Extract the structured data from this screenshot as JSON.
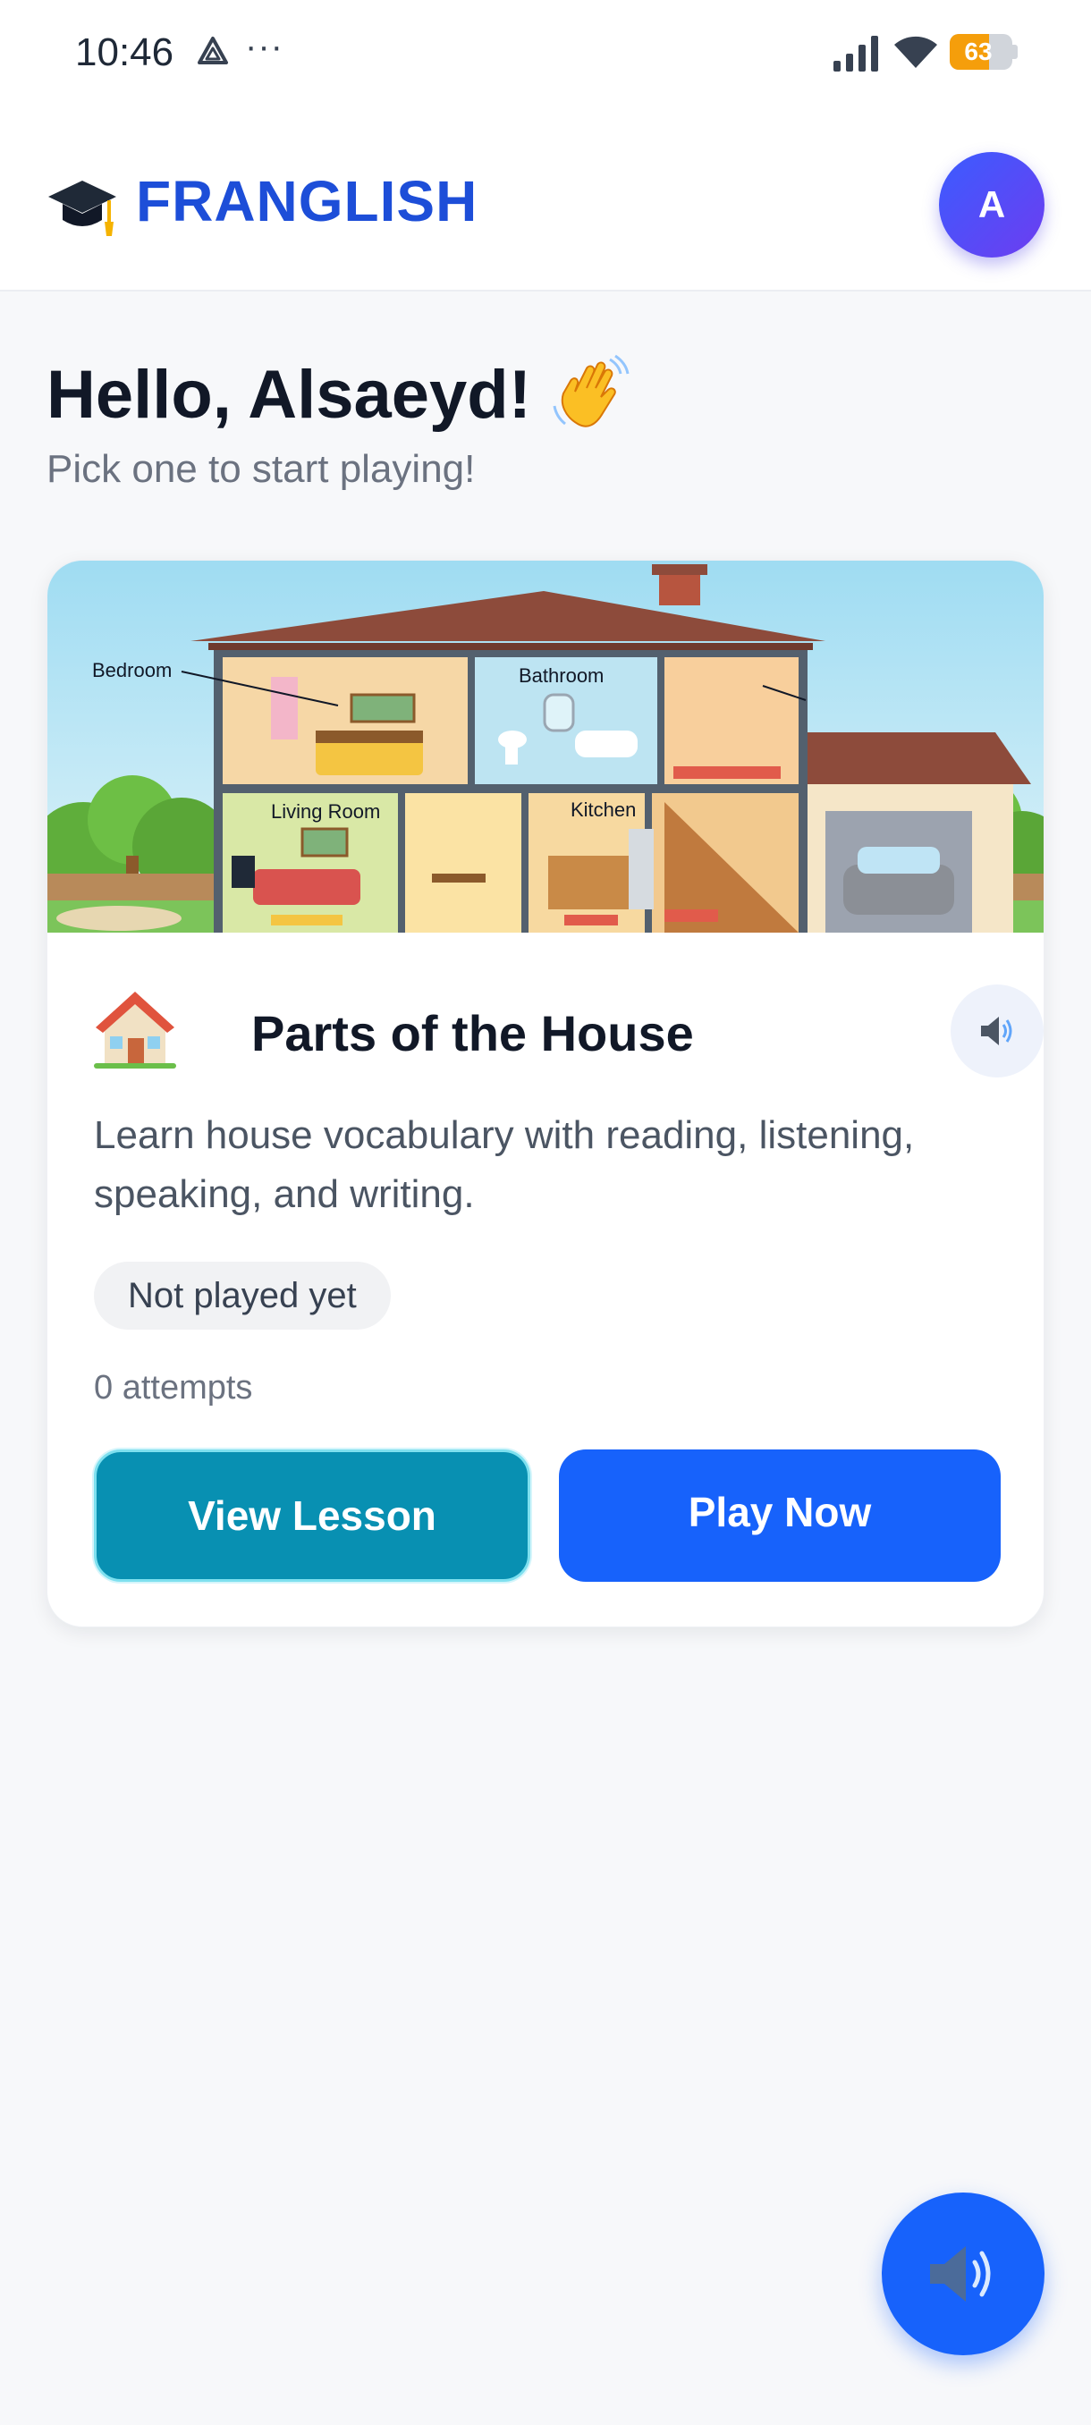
{
  "status_bar": {
    "time": "10:46",
    "more_glyph": "···",
    "battery_level": "63",
    "icons": [
      "drive-icon",
      "signal-icon",
      "wifi-icon",
      "battery-icon"
    ]
  },
  "header": {
    "logo_icon": "graduation-cap-icon",
    "app_name": "FRANGLISH",
    "avatar_initial": "A"
  },
  "greeting": {
    "title": "Hello, Alsaeyd!",
    "emoji": "waving-hand-icon",
    "subtitle": "Pick one to start playing!"
  },
  "lesson_card": {
    "image": {
      "labels": {
        "bedroom": "Bedroom",
        "bathroom": "Bathroom",
        "living_room": "Living Room",
        "kitchen": "Kitchen"
      }
    },
    "icon": "house-icon",
    "title": "Parts of the House",
    "description": "Learn house vocabulary with reading, listening, speaking, and writing.",
    "status_badge": "Not played yet",
    "attempts": "0 attempts",
    "buttons": {
      "view_lesson": "View Lesson",
      "play_now": "Play Now"
    }
  },
  "fab": {
    "icon": "speaker-icon"
  },
  "colors": {
    "brand": "#1d4ed8",
    "primary_button": "#1762fb",
    "secondary_button": "#0890b2",
    "background": "#f7f8fa"
  }
}
